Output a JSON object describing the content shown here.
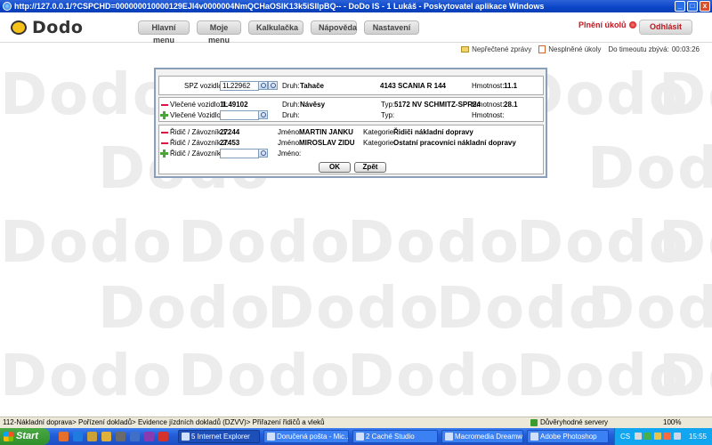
{
  "window": {
    "title": "http://127.0.0.1/?CSPCHD=000000010000129EJI4v0000004NmQCHaOSIK13k5iSIlpBQ-- - DoDo IS - 1 Lukáš - Poskytovatel aplikace Windows"
  },
  "app": {
    "logo_text": "Dodo",
    "nav": [
      "Hlavní menu",
      "Moje menu",
      "Kalkulačka",
      "Nápověda",
      "Nastavení"
    ],
    "plneni_label": "Plnění úkolů",
    "logout_label": "Odhlásit",
    "watermark_text": "Dodo"
  },
  "status": {
    "unread_label": "Nepřečtené zprávy",
    "unfinished_label": "Nesplněné úkoly",
    "timeout_label": "Do timeoutu zbývá:",
    "timeout_value": "00:03:26"
  },
  "dialog": {
    "vehicle": {
      "spz_label": "SPZ vozidla:",
      "spz_value": "1L22962",
      "druh_label": "Druh:",
      "druh_value": "Tahače",
      "model_value": "4143 SCANIA R 144",
      "hmotnost_label": "Hmotnost:",
      "hmotnost_value": "11.1"
    },
    "trailers": [
      {
        "label": "Vlečené vozidlo 1:",
        "value": "1L49102",
        "druh_label": "Druh:",
        "druh_value": "Návěsy",
        "typ_label": "Typ:",
        "typ_value": "5172 NV SCHMITZ-SPR24",
        "hmotnost_label": "Hmotnost:",
        "hmotnost_value": "28.1"
      },
      {
        "label": "Vlečené Vozidlo 2:",
        "value": "",
        "druh_label": "Druh:",
        "druh_value": "",
        "typ_label": "Typ:",
        "typ_value": "",
        "hmotnost_label": "Hmotnost:",
        "hmotnost_value": ""
      }
    ],
    "drivers": [
      {
        "label": "Řidič / Závozník 1:",
        "value": "27244",
        "jmeno_label": "Jméno:",
        "jmeno_value": "MARTIN JANKU",
        "kategorie_label": "Kategorie:",
        "kategorie_value": "Řidiči nákladní dopravy"
      },
      {
        "label": "Řidič / Závozník 2:",
        "value": "27453",
        "jmeno_label": "Jméno:",
        "jmeno_value": "MIROSLAV ZIDU",
        "kategorie_label": "Kategorie:",
        "kategorie_value": "Ostatní pracovníci nákladní dopravy"
      },
      {
        "label": "Řidič / Závozník 3:",
        "value": "",
        "jmeno_label": "Jméno:",
        "jmeno_value": ""
      }
    ],
    "ok_label": "OK",
    "back_label": "Zpět"
  },
  "ie_status": {
    "breadcrumb": "112-Nákladní doprava> Pořízení dokladů> Evidence jízdních dokladů (DZVV)> Přiřazení řidičů a vleků",
    "zone": "Důvěryhodné servery",
    "zoom": "100%"
  },
  "taskbar": {
    "start_label": "Start",
    "buttons": [
      "5 Internet Explorer",
      "Doručená pošta - Mic...",
      "2 Caché Studio",
      "Macromedia Dreamw...",
      "Adobe Photoshop"
    ],
    "lang": "CS",
    "clock": "15:55"
  },
  "colors": {
    "title_bar": "#0a45c8",
    "brand_red": "#c0171f",
    "plus_green": "#4ba53a",
    "minus_red": "#d14"
  }
}
